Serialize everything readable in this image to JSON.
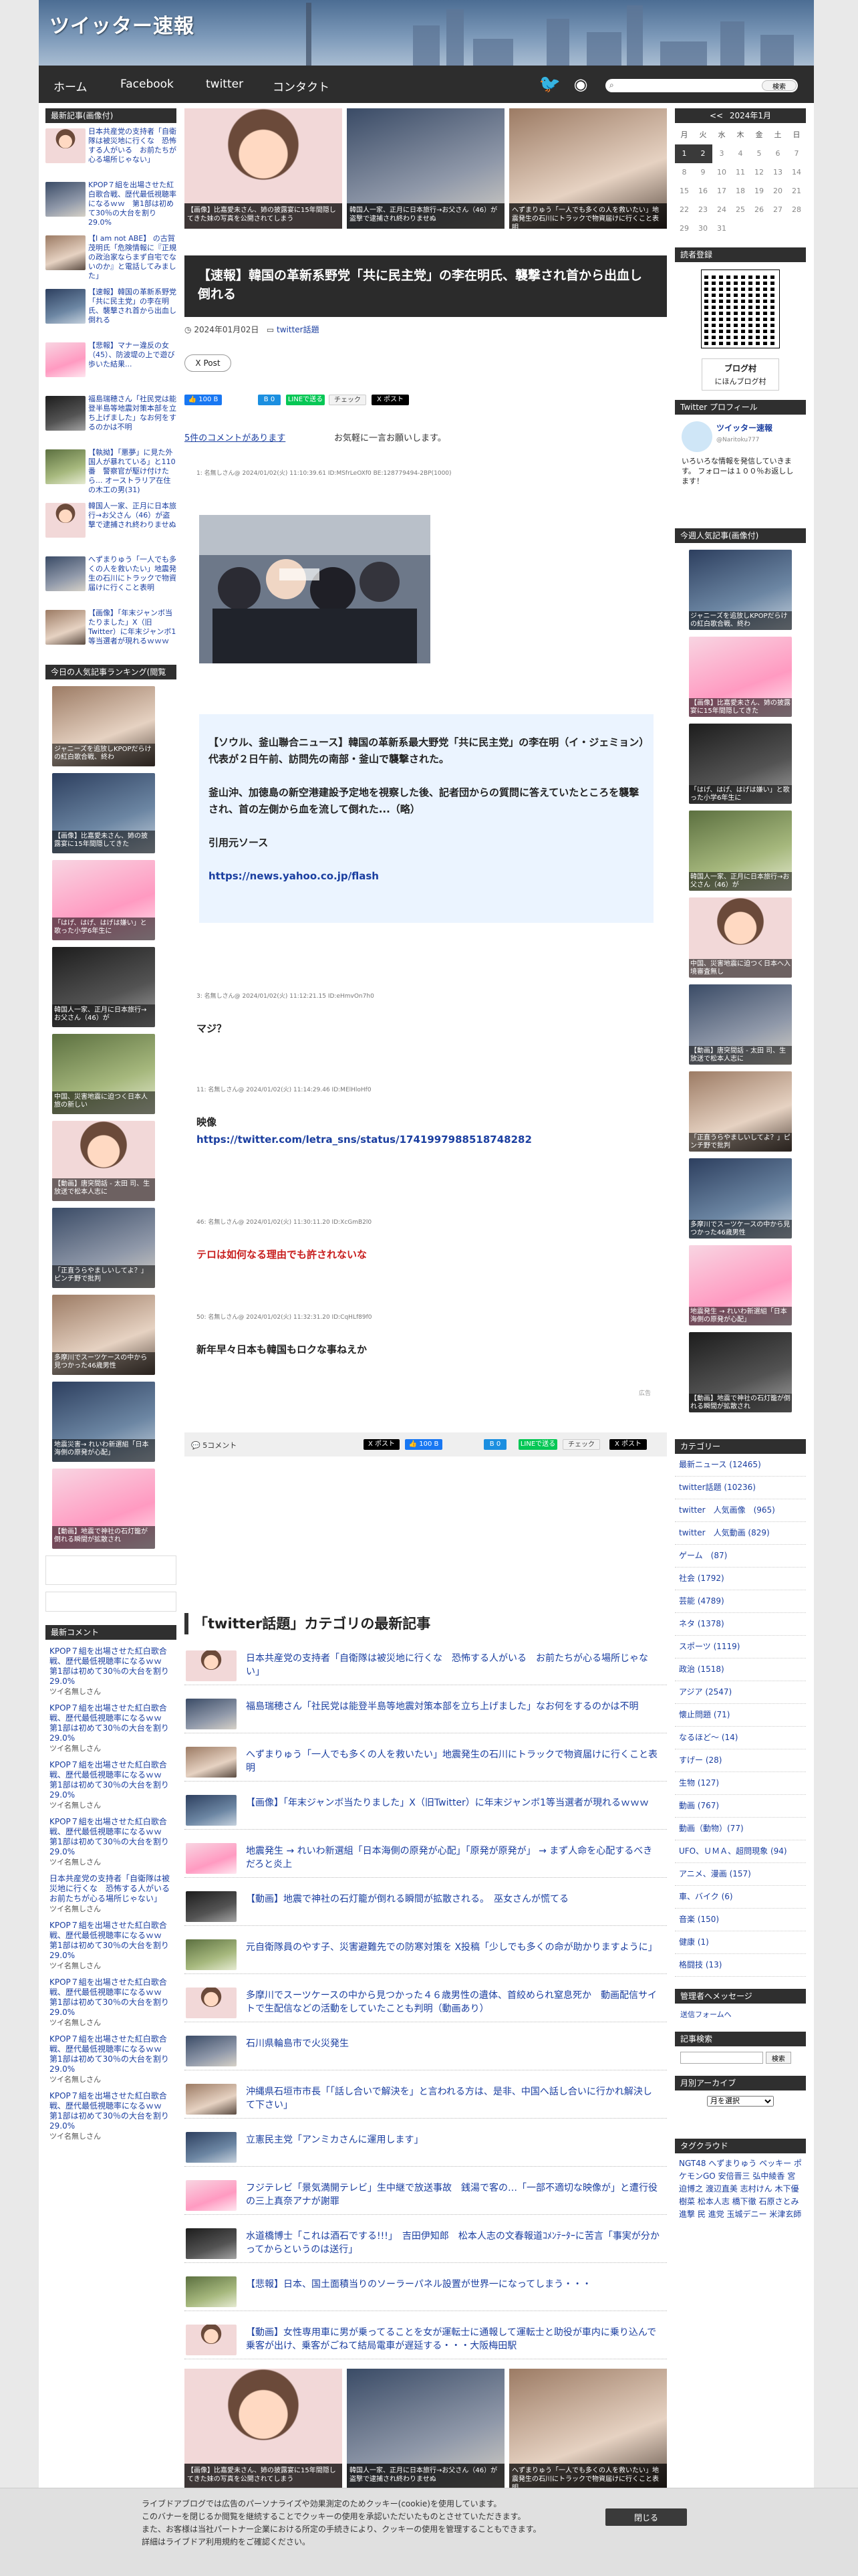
{
  "site": {
    "title": "ツイッター速報"
  },
  "nav": {
    "items": [
      "ホーム",
      "Facebook",
      "twitter",
      "コンタクト"
    ],
    "search_button": "検索"
  },
  "left": {
    "latest_head": "最新記事(画像付)",
    "latest": [
      "日本共産党の支持者「自衛隊は被災地に行くな　恐怖する人がいる　お前たちが心る場所じゃない」",
      "KPOP７組を出場させた紅白歌合戦、歴代最低視聴率になるｗｗ　第1部は初めて30％の大台を割り29.0%",
      "【I am not ABE】 の古賀茂明氏「危険情報に『正規の政治家ならまず自宅でないのか』と電話してみました」",
      "【速報】韓国の革新系野党「共に民主党」の李在明氏、襲撃され首から出血し倒れる",
      "【悲報】マナー違反の女（45）、防波堤の上で遊び歩いた結果...",
      "福島瑞穂さん「社民党は能登半島等地震対策本部を立ち上げました」なお何をするのかは不明",
      "【執拗】「悪夢」に見た外国人が暴れている」と110番　警察官が駆け付けたら... オーストラリア在住の木工の男(31)",
      "韓国人一家、正月に日本旅行→お父さん（46）が盗撃で逮捕され終わりませぬ",
      "へずまりゅう「一人でも多くの人を救いたい」地震発生の石川にトラックで物資届けに行くこと表明",
      "【画像】「年末ジャンボ当たりました」X（旧Twitter）に年末ジャンボ1等当選者が現れるｗｗｗ"
    ],
    "ranking_head": "今日の人気記事ランキング(閲覧数)",
    "ranking": [
      "ジャニーズを追放しKPOPだらけの紅白歌合戦、終わ",
      "【画像】比嘉愛未さん、姉の披露宴に15年間隠してきた",
      "「はげ、はげ、はげは嫌い」と歌った小学6年生に",
      "韓国人一家、正月に日本旅行→お父さん（46）が",
      "中国、災害地震に迫つく日本人旅の新しい",
      "【動画】唐突間話 - 太田 司、生放送で松本人志に",
      "「正直うらやましいしてよ？」ピンチ野で批判",
      "多摩川でスーツケースの中から見つかった46歳男性",
      "地震災害→ れいわ新選組「日本海側の原発が心配」",
      "【動画】地震で神社の石灯籠が倒れる瞬間が拡散され"
    ],
    "comments_head": "最新コメント",
    "comments": [
      {
        "title": "KPOP７組を出場させた紅白歌合戦、歴代最低視聴率になるｗｗ　第1部は初めて30％の大台を割り29.0%",
        "who": "ツイ名無しさん"
      },
      {
        "title": "KPOP７組を出場させた紅白歌合戦、歴代最低視聴率になるｗｗ　第1部は初めて30％の大台を割り29.0%",
        "who": "ツイ名無しさん"
      },
      {
        "title": "KPOP７組を出場させた紅白歌合戦、歴代最低視聴率になるｗｗ　第1部は初めて30％の大台を割り29.0%",
        "who": "ツイ名無しさん"
      },
      {
        "title": "KPOP７組を出場させた紅白歌合戦、歴代最低視聴率になるｗｗ　第1部は初めて30％の大台を割り29.0%",
        "who": "ツイ名無しさん"
      },
      {
        "title": "日本共産党の支持者「自衛隊は被災地に行くな　恐怖する人がいる　お前たちが心る場所じゃない」",
        "who": "ツイ名無しさん"
      },
      {
        "title": "KPOP７組を出場させた紅白歌合戦、歴代最低視聴率になるｗｗ　第1部は初めて30％の大台を割り29.0%",
        "who": "ツイ名無しさん"
      },
      {
        "title": "KPOP７組を出場させた紅白歌合戦、歴代最低視聴率になるｗｗ　第1部は初めて30％の大台を割り29.0%",
        "who": "ツイ名無しさん"
      },
      {
        "title": "KPOP７組を出場させた紅白歌合戦、歴代最低視聴率になるｗｗ　第1部は初めて30％の大台を割り29.0%",
        "who": "ツイ名無しさん"
      },
      {
        "title": "KPOP７組を出場させた紅白歌合戦、歴代最低視聴率になるｗｗ　第1部は初めて30％の大台を割り29.0%",
        "who": "ツイ名無しさん"
      }
    ]
  },
  "top_grid": [
    "【画像】比嘉愛未さん、姉の披露宴に15年間隠してきた妹の写真を公開されてしまう",
    "韓国人一家、正月に日本旅行→お父さん（46）が盗撃で逮捕され終わりませぬ",
    "へずまりゅう「一人でも多くの人を救いたい」地震発生の石川にトラックで物資届けに行くこと表明"
  ],
  "article": {
    "title": "【速報】韓国の革新系野党「共に民主党」の李在明氏、襲撃され首から出血し倒れる",
    "date": "2024年01月02日",
    "category": "twitter話題",
    "x_post": "X Post",
    "comment_link": "5件のコメントがあります",
    "comment_invite": "お気軽に一言お願いします。",
    "res1_head": "1: 名無しさん@ 2024/01/02(火) 11:10:39.61 ID:MSfrLeOXf0 BE:128779494-2BP(1000)",
    "quote_p1": "【ソウル、釜山聯合ニュース】韓国の革新系最大野党「共に民主党」の李在明（イ・ジェミョン）代表が２日午前、訪問先の南部・釜山で襲撃された。",
    "quote_p2": "釜山沖、加徳島の新空港建設予定地を視察した後、記者団からの質問に答えていたところを襲撃され、首の左側から血を流して倒れた...（略）",
    "quote_src": "引用元ソース",
    "quote_url": "https://news.yahoo.co.jp/flash",
    "res3_head": "3: 名無しさん@ 2024/01/02(火) 11:12:21.15 ID:eHmvOn7h0",
    "res3_body": "マジ？",
    "res11_head": "11: 名無しさん@ 2024/01/02(火) 11:14:29.46 ID:MElHloHf0",
    "res11_body": "映像",
    "res11_url": "https://twitter.com/letra_sns/status/1741997988518748282",
    "res46_head": "46: 名無しさん@ 2024/01/02(火) 11:30:11.20 ID:XcGmB2l0",
    "res46_body": "テロは如何なる理由でも許されないな",
    "res50_head": "50: 名無しさん@ 2024/01/02(火) 11:32:31.20 ID:CqHLf89f0",
    "res50_body": "新年早々日本も韓国もロクな事ねえか",
    "ad_note": "広告",
    "comment_bar": "5コメント"
  },
  "category": {
    "head": "「twitter話題」カテゴリの最新記事",
    "items": [
      "日本共産党の支持者「自衛隊は被災地に行くな　恐怖する人がいる　お前たちが心る場所じゃない」",
      "福島瑞穂さん「社民党は能登半島等地震対策本部を立ち上げました」なお何をするのかは不明",
      "へずまりゅう「一人でも多くの人を救いたい」地震発生の石川にトラックで物資届けに行くこと表明",
      "【画像】「年末ジャンボ当たりました」X（旧Twitter）に年末ジャンボ1等当選者が現れるｗｗｗ",
      "地震発生 → れいわ新選組「日本海側の原発が心配」「原発が原発が」 → まず人命を心配するべきだろと炎上",
      "【動画】地震で神社の石灯籠が倒れる瞬間が拡散される。　巫女さんが慌てる",
      "元自衛隊員のやす子、災害避難先での防寒対策を X投稿「少しでも多くの命が助かりますように」",
      "多摩川でスーツケースの中から見つかった４６歳男性の遺体、首絞められ窒息死か　動画配信サイトで生配信などの活動をしていたことも判明（動画あり）",
      "石川県輪島市で火災発生",
      "沖縄県石垣市市長「「話し合いで解決を」と言われる方は、是非、中国へ話し合いに行かれ解決して下さい」",
      "立憲民主党「アンミカさんに運用します」",
      "フジテレビ「景気満開テレビ」生中継で放送事故　銭湯で客の…「一部不適切な映像が」と遭行役の三上真奈アナが謝罪",
      "水道橋博士「これは酒石でする!!!」　吉田伊知郎　松本人志の文春報道ｺﾒﾝﾃｰﾀｰに苦言「事実が分かってからというのは送行」",
      "【悲報】日本、国土面積当りのソーラーパネル設置が世界一になってしまう・・・",
      "【動画】女性専用車に男が乗ってることを女が運転士に通報して運転士と助役が車内に乗り込んで乗客が出け、乗客がごねて結局電車が遅延する・・・大阪梅田駅"
    ]
  },
  "bottom_grid": [
    "【画像】比嘉愛未さん、姉の披露宴に15年間隠してきた妹の写真を公開されてしまう",
    "韓国人一家、正月に日本旅行→お父さん（46）が盗撃で逮捕され終わりませぬ",
    "へずまりゅう「一人でも多くの人を救いたい」地震発生の石川にトラックで物資届けに行くこと表明"
  ],
  "right": {
    "cal_prev": "<<",
    "cal_title": "2024年1月",
    "cal_days": [
      "月",
      "火",
      "水",
      "木",
      "金",
      "土",
      "日"
    ],
    "cal_cells": [
      "1",
      "2",
      "3",
      "4",
      "5",
      "6",
      "7",
      "8",
      "9",
      "10",
      "11",
      "12",
      "13",
      "14",
      "15",
      "16",
      "17",
      "18",
      "19",
      "20",
      "21",
      "22",
      "23",
      "24",
      "25",
      "26",
      "27",
      "28",
      "29",
      "30",
      "31",
      "",
      "",
      "",
      ""
    ],
    "reader_head": "読者登録",
    "blogmura_1": "ブログ村",
    "blogmura_2": "にほんブログ村",
    "profile_head": "Twitter プロフィール",
    "profile_name": "ツイッター速報",
    "profile_id": "@Naritoku777",
    "profile_bio": "いろいろな情報を発信していきます。 フォローは１００％お返しします！",
    "popular_head": "今週人気記事(画像付)",
    "popular": [
      "ジャニーズを追放しKPOPだらけの紅白歌合戦、終わ",
      "【画像】比嘉愛未さん、姉の披露宴に15年間隠してきた",
      "「はげ、はげ、はげは嫌い」と歌った小学6年生に",
      "韓国人一家、正月に日本旅行→お父さん（46）が",
      "中国、災害地震に迫つく日本へ入境審査無し",
      "【動画】唐突間話 - 太田 司、生放送で松本人志に",
      "「正直うらやましいしてよ？」ピンチ野で批判",
      "多摩川でスーツケースの中から見つかった46歳男性",
      "地震発生 → れいわ新選組「日本海側の原発が心配」",
      "【動画】地震で神社の石灯籠が倒れる瞬間が拡散され"
    ],
    "category_head": "カテゴリー",
    "categories": [
      "最新ニュース (12465)",
      "twitter話題 (10236)",
      "twitter　人気画像　(965)",
      "twitter　人気動画 (829)",
      "ゲーム　(87)",
      "社会 (1792)",
      "芸能 (4789)",
      "ネタ (1378)",
      "スポーツ (1119)",
      "政治 (1518)",
      "アジア (2547)",
      "懐止問題 (71)",
      "なるほど～ (14)",
      "すげー (28)",
      "生物 (127)",
      "動画 (767)",
      "動画（動物）(77)",
      "UFO、ＵＭＡ、超問現象 (94)",
      "アニメ、漫画 (157)",
      "車、バイク (6)",
      "音楽 (150)",
      "健康 (1)",
      "格闘技 (13)"
    ],
    "admin_head": "管理者へメッセージ",
    "admin_link": "送信フォームへ",
    "search_head": "記事検索",
    "search_btn": "検索",
    "archive_head": "月別アーカイブ",
    "archive_select": "月を選択",
    "tag_head": "タグクラウド",
    "tags": "NGT48 へずまりゅう ペッキー ポケモンGO 安倍晋三 弘中綾香 宮迫博之 渡辺直美 志村けん 木下優樹菜 松本人志 橋下徹 石原さとみ 進撃 民 進党 玉城デニー 米津玄師"
  },
  "cookie": {
    "l1": "ライブドアブログでは広告のパーソナライズや効果測定のためクッキー(cookie)を使用しています。",
    "l2": "このバナーを閉じるか閲覧を継続することでクッキーの使用を承認いただいたものとさせていただきます。",
    "l3": "また、お客様は当社パートナー企業における所定の手続きにより、クッキーの使用を管理することもできます。",
    "l4": "詳細はライブドア利用規約をご確認ください。",
    "close": "閉じる"
  },
  "colors": {
    "header_bg": "#5b7da4",
    "nav_bg": "#2d2d2d",
    "title_bg": "#2b2b2b",
    "quote_bg": "#ebf4ff",
    "accent_red": "#c81e1e",
    "link": "#1a3ea0"
  }
}
